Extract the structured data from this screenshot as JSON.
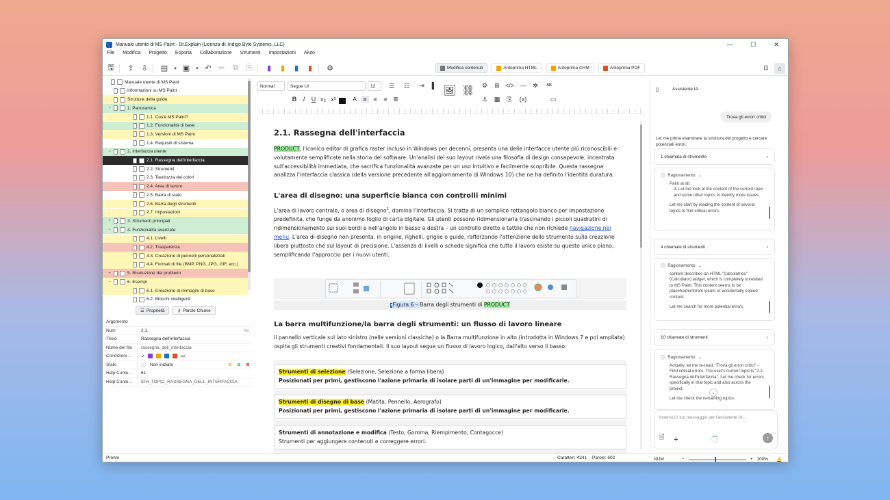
{
  "window": {
    "title": "Manuale utente di MS Paint - Dr.Explain (Licenza di: Indigo Byte Systems, LLC)"
  },
  "menu": [
    "File",
    "Modifica",
    "Progetto",
    "Esporta",
    "Collaborazione",
    "Strumenti",
    "Impostazioni",
    "Aiuto"
  ],
  "toolbar": {
    "modes": [
      "Modifica contenuti",
      "Anteprima HTML",
      "Anteprima CHM",
      "Anteprima PDF"
    ]
  },
  "tree": [
    {
      "label": "Manuale utente di MS Paint",
      "depth": 0,
      "color": "#ffffff"
    },
    {
      "label": "Informazioni su MS Paint",
      "depth": 1,
      "color": "#ffffff"
    },
    {
      "label": "Struttura della guida",
      "depth": 1,
      "color": "#fff6b8"
    },
    {
      "label": "1. Panoramica",
      "depth": 1,
      "color": "#cdeed3",
      "ex": "−"
    },
    {
      "label": "1.1. Cos'è MS Paint?",
      "depth": 2,
      "color": "#fff6b8"
    },
    {
      "label": "1.2. Funzionalità di base",
      "depth": 2,
      "color": "#cdeed3"
    },
    {
      "label": "1.3. Versioni di MS Paint",
      "depth": 2,
      "color": "#fff6b8"
    },
    {
      "label": "1.4. Requisiti di sistema",
      "depth": 2,
      "color": "#ffffff"
    },
    {
      "label": "2. Interfaccia utente",
      "depth": 1,
      "color": "#cdeed3",
      "ex": "−"
    },
    {
      "label": "2.1. Rassegna dell'interfaccia",
      "depth": 2,
      "color": "#2b2b2b",
      "sel": true
    },
    {
      "label": "2.2. Strumenti",
      "depth": 2,
      "color": "#ffffff"
    },
    {
      "label": "2.3. Tavolozza dei colori",
      "depth": 2,
      "color": "#ffffff"
    },
    {
      "label": "2.4. Area di lavoro",
      "depth": 2,
      "color": "#f7c3b9"
    },
    {
      "label": "2.5. Barra di stato",
      "depth": 2,
      "color": "#ffffff"
    },
    {
      "label": "2.6. Barra degli strumenti",
      "depth": 2,
      "color": "#fff6b8"
    },
    {
      "label": "2.7. Impostazioni",
      "depth": 2,
      "color": "#fff6b8"
    },
    {
      "label": "3. Strumenti principali",
      "depth": 1,
      "color": "#cdeed3",
      "ex": "+"
    },
    {
      "label": "4. Funzionalità avanzate",
      "depth": 1,
      "color": "#cdeed3",
      "ex": "−"
    },
    {
      "label": "4.1. Livelli",
      "depth": 2,
      "color": "#fff6b8"
    },
    {
      "label": "4.2. Trasparenza",
      "depth": 2,
      "color": "#f7c3b9"
    },
    {
      "label": "4.3. Creazione di pennelli personalizzati",
      "depth": 2,
      "color": "#fff6b8"
    },
    {
      "label": "4.4. Formati di file (BMP, PNG, JPG, GIF, ecc.)",
      "depth": 2,
      "color": "#fff6b8"
    },
    {
      "label": "5. Risoluzione dei problemi",
      "depth": 1,
      "color": "#f7c3b9",
      "ex": "+"
    },
    {
      "label": "6. Esempi",
      "depth": 1,
      "color": "#fff6b8",
      "ex": "−"
    },
    {
      "label": "6.1. Creazione di immagini di base",
      "depth": 2,
      "color": "#fff6b8"
    },
    {
      "label": "6.2. Blocchi intelligenti",
      "depth": 2,
      "color": "#ffffff"
    }
  ],
  "left_buttons": {
    "props": "Proprietà",
    "keywords": "Parole Chiave"
  },
  "props": {
    "header": "Argomento",
    "rows": [
      {
        "k": "Num",
        "v": "2.1.",
        "extra": "No"
      },
      {
        "k": "Titolo",
        "v": "Rassegna dell'interfaccia"
      },
      {
        "k": "Nome del file",
        "v": "rassegna_dell_interfaccia"
      },
      {
        "k": "Condizioni ...",
        "v": ""
      },
      {
        "k": "Stato",
        "v": "Non iniziato"
      },
      {
        "k": "Help Conte...",
        "v": "61"
      },
      {
        "k": "Help Conte...",
        "v": "IDH_TOPIC_RASSEGNA_DELL_INTERFACCIA"
      }
    ]
  },
  "status_left": "Pronto",
  "format": {
    "style": "Normal",
    "font": "Segoe UI",
    "size": "12"
  },
  "doc": {
    "title": "2.1. Rassegna dell'interfaccia",
    "p1_pre": "PRODUCT",
    "p1": ", l'iconico editor di grafica raster incluso in Windows per decenni, presenta una delle interfacce utente più riconoscibili e volutamente semplificate nella storia del software. Un'analisi del suo layout rivela una filosofia di design consapevole, incentrata sull'accessibilità immediata, che sacrifica funzionalità avanzate per un uso intuitivo e facilmente scopribile. Questa rassegna analizza l'interfaccia classica (della versione precedente all'aggiornamento di Windows 10) che ne ha definito l'identità duratura.",
    "h2a": "L'area di disegno: una superficie bianca con controlli minimi",
    "p2a": "L'area di lavoro centrale, o area di disegno",
    "p2sup": "1",
    "p2b": ", domina l'interfaccia. Si tratta di un semplice rettangolo bianco per impostazione predefinita, che funge da anonimo foglio di carta digitale. Gli utenti possono ridimensionarla trascinando i piccoli quadratini di ridimensionamento sui suoi bordi e nell'angolo in basso a destra – un controllo diretto e tattile che non richiede ",
    "p2link": "navigazione nei menu",
    "p2c": ". L'area di disegno non presenta, in origine, righelli, griglie o guide, rafforzando l'attenzione dello strumento sulla creazione libera piuttosto che sul layout di precisione. L'assenza di livelli o schede significa che tutto il lavoro esiste su questo unico piano, semplificando l'approccio per i nuovi utenti.",
    "caption_a": "Figura 6 – ",
    "caption_b": "Barra degli strumenti di ",
    "caption_c": "PRODUCT",
    "h2b": "La barra multifunzione/la barra degli strumenti: un flusso di lavoro lineare",
    "p3": "Il pannello verticale sul lato sinistro (nelle versioni classiche) o la Barra multifunzione in alto (introdotta in Windows 7 e poi ampliata) ospita gli strumenti creativi fondamentali. Il suo layout segue un flusso di lavoro logico, dall'alto verso il basso:",
    "boxes": [
      {
        "title": "Strumenti di selezione",
        "sub": " (Selezione, Selezione a forma libera)",
        "desc": "Posizionati per primi, gestiscono l'azione primaria di isolare parti di un'immagine per modificarle.",
        "hl": true
      },
      {
        "title": "Strumenti di disegno di base",
        "sub": " (Matita, Pennello, Aerografo)",
        "desc": "Posizionati per primi, gestiscono l'azione primaria di isolare parti di un'immagine per modificarle.",
        "hl": true
      },
      {
        "title": "Strumenti di annotazione e modifica",
        "sub": " (Testo, Gomma, Riempimento, Contagocce)",
        "desc": "Strumenti per aggiungere contenuti e correggere errori.",
        "hl": false
      }
    ]
  },
  "status_center": {
    "chars": "Caratteri: 4341",
    "words": "Parole: 602"
  },
  "assistant": {
    "title": "Assistente IA",
    "user_msg": "Trova gli errori critici",
    "intro": "Let me prima esaminare la struttura del progetto e cercare potenziali errori.",
    "cards": [
      "1 chiamata di strumento",
      "4 chiamate di strumenti",
      "10 chiamate di strumenti"
    ],
    "reasoning_label": "Ragionamento",
    "r1": [
      "Paint at all.",
      "3. Let me look at the content of the current topic and some other topics to identify more issues.",
      "Let me start by reading the content of several topics to find critical errors."
    ],
    "r2": [
      "content describes an HTML \"Calcolatrice\" (Calculator) widget, which is completely unrelated to MS Paint. This content seems to be placeholder/lorem ipsum or accidentally copied content.",
      "Let me search for more potential errors."
    ],
    "r3": [
      "Actually, let me re-read: \"Trova gli errori critici\" - Find critical errors. The user's current topic is \"2.1. Rassegna dell'interfaccia\". Let me check for errors specifically in that topic and also across the project.",
      "Let me check the remaining topics."
    ],
    "placeholder": "Inserisci il tuo messaggio per l'assistente IA..."
  },
  "status_right": {
    "num": "NUM",
    "zoom": "100%"
  },
  "colors": {
    "selected": "#2b2b2b",
    "green": "#cdeed3",
    "yellow": "#fff6b8",
    "red": "#f7c3b9",
    "accent": "#1b5fb8"
  }
}
